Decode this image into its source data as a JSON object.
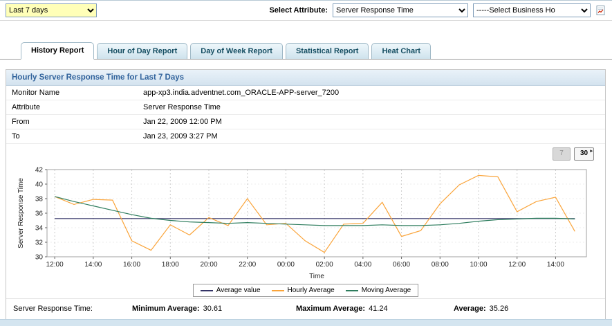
{
  "toolbar": {
    "period_select": {
      "value": "Last 7 days"
    },
    "attribute_label": "Select Attribute:",
    "attribute_select": {
      "value": "Server Response Time"
    },
    "business_hours_select": {
      "value": "-----Select Business Ho"
    },
    "export_icon": "report-export-icon"
  },
  "tabs": [
    {
      "label": "History Report",
      "active": true
    },
    {
      "label": "Hour of Day Report",
      "active": false
    },
    {
      "label": "Day of Week Report",
      "active": false
    },
    {
      "label": "Statistical Report",
      "active": false
    },
    {
      "label": "Heat Chart",
      "active": false
    }
  ],
  "report": {
    "title": "Hourly Server Response Time for Last 7 Days",
    "fields": [
      {
        "label": "Monitor Name",
        "value": "app-xp3.india.adventnet.com_ORACLE-APP-server_7200"
      },
      {
        "label": "Attribute",
        "value": "Server Response Time"
      },
      {
        "label": "From",
        "value": "Jan 22, 2009 12:00 PM"
      },
      {
        "label": "To",
        "value": "Jan 23, 2009 3:27 PM"
      }
    ],
    "range_buttons": {
      "seven": "7",
      "thirty": "30"
    }
  },
  "chart_data": {
    "type": "line",
    "title": "",
    "xlabel": "Time",
    "ylabel": "Server Response Time",
    "ylim": [
      30,
      42
    ],
    "yticks": [
      30,
      32,
      34,
      36,
      38,
      40,
      42
    ],
    "xlim": [
      11.6,
      39.6
    ],
    "xticks": [
      12,
      14,
      16,
      18,
      20,
      22,
      24,
      26,
      28,
      30,
      32,
      34,
      36,
      38
    ],
    "xtick_labels": [
      "12:00",
      "14:00",
      "16:00",
      "18:00",
      "20:00",
      "22:00",
      "00:00",
      "02:00",
      "04:00",
      "06:00",
      "08:00",
      "10:00",
      "12:00",
      "14:00"
    ],
    "x_hours": [
      12,
      13,
      14,
      15,
      16,
      17,
      18,
      19,
      20,
      21,
      22,
      23,
      24,
      25,
      26,
      27,
      28,
      29,
      30,
      31,
      32,
      33,
      34,
      35,
      36,
      37,
      38,
      39
    ],
    "grid": "vertical-dotted",
    "legend_position": "bottom",
    "series": [
      {
        "name": "Average value",
        "color": "#333366",
        "constant": 35.26,
        "values": null
      },
      {
        "name": "Hourly Average",
        "color": "#FAA43A",
        "constant": null,
        "values": [
          38.3,
          37.2,
          37.9,
          37.8,
          32.2,
          30.9,
          34.4,
          33.0,
          35.4,
          34.3,
          38.0,
          34.4,
          34.6,
          32.2,
          30.6,
          34.5,
          34.6,
          37.5,
          32.8,
          33.6,
          37.3,
          39.9,
          41.2,
          41.0,
          36.2,
          37.6,
          38.2,
          33.5
        ]
      },
      {
        "name": "Moving Average",
        "color": "#2E7D5E",
        "constant": null,
        "values": [
          38.3,
          37.6,
          37.0,
          36.4,
          35.8,
          35.3,
          35.0,
          34.8,
          34.7,
          34.6,
          34.7,
          34.6,
          34.5,
          34.4,
          34.3,
          34.3,
          34.3,
          34.4,
          34.3,
          34.3,
          34.4,
          34.6,
          34.9,
          35.1,
          35.2,
          35.3,
          35.3,
          35.2
        ]
      }
    ]
  },
  "summary": {
    "name_label": "Server Response Time:",
    "min_label": "Minimum Average:",
    "min_value": "30.61",
    "max_label": "Maximum Average:",
    "max_value": "41.24",
    "avg_label": "Average:",
    "avg_value": "35.26"
  }
}
